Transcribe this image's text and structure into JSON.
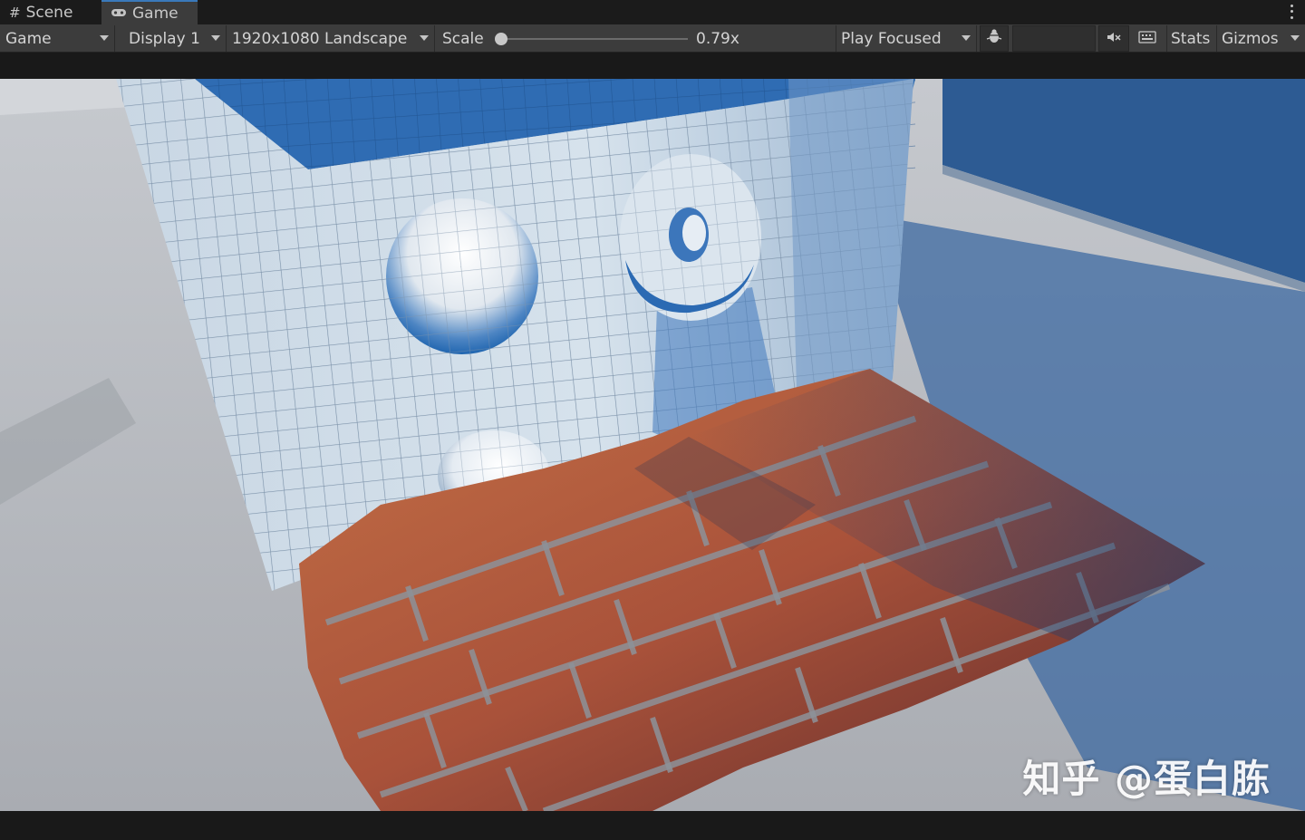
{
  "tabs": [
    {
      "label": "Scene",
      "icon": "grid-icon"
    },
    {
      "label": "Game",
      "icon": "gamepad-icon"
    }
  ],
  "toolbar": {
    "view_mode": "Game",
    "display": "Display 1",
    "resolution": "1920x1080 Landscape",
    "scale_label": "Scale",
    "scale_value": "0.79x",
    "scale_fraction": 0.0,
    "play_mode": "Play Focused",
    "stats_label": "Stats",
    "gizmos_label": "Gizmos"
  },
  "watermark": "知乎 @蛋白胨",
  "colors": {
    "accent": "#3a79bb",
    "panel": "#3c3c3c",
    "dark": "#1b1b1b"
  }
}
